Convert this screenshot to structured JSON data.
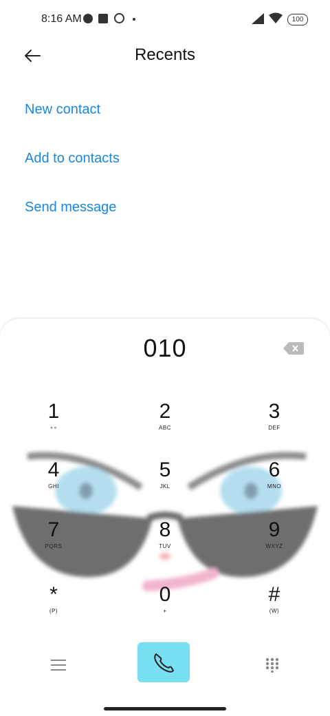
{
  "status_bar": {
    "time": "8:16 AM",
    "battery": "100"
  },
  "header": {
    "title": "Recents"
  },
  "actions": {
    "new_contact": "New contact",
    "add_to_contacts": "Add to contacts",
    "send_message": "Send message"
  },
  "dialer": {
    "number": "010",
    "keys": [
      {
        "digit": "1",
        "letters": "∘∘"
      },
      {
        "digit": "2",
        "letters": "ABC"
      },
      {
        "digit": "3",
        "letters": "DEF"
      },
      {
        "digit": "4",
        "letters": "GHI"
      },
      {
        "digit": "5",
        "letters": "JKL"
      },
      {
        "digit": "6",
        "letters": "MNO"
      },
      {
        "digit": "7",
        "letters": "PQRS"
      },
      {
        "digit": "8",
        "letters": "TUV"
      },
      {
        "digit": "9",
        "letters": "WXYZ"
      },
      {
        "digit": "*",
        "letters": "(P)"
      },
      {
        "digit": "0",
        "letters": "+"
      },
      {
        "digit": "#",
        "letters": "(W)"
      }
    ]
  },
  "colors": {
    "link": "#1a87e0",
    "call_button": "#78dff0",
    "glasses": "#555555"
  },
  "icons": [
    "back-arrow-icon",
    "backspace-icon",
    "menu-icon",
    "phone-icon",
    "keypad-icon"
  ]
}
